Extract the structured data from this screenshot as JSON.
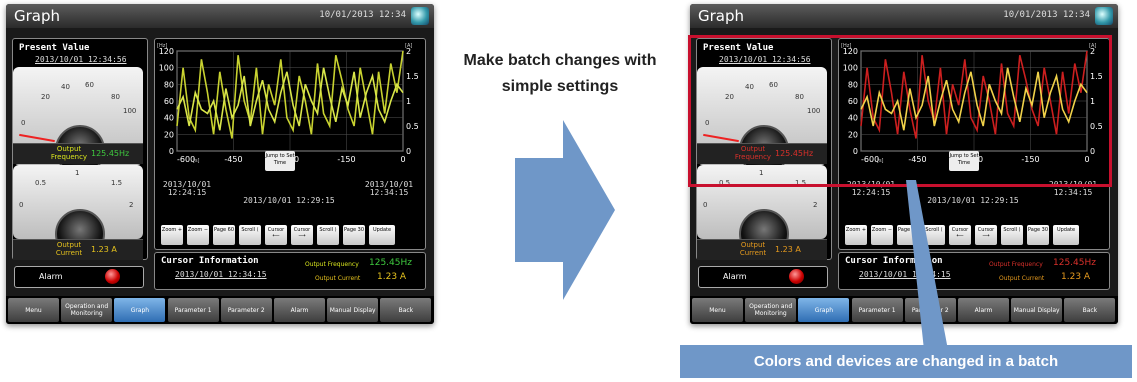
{
  "screens": [
    {
      "title": "Graph",
      "datetime": "10/01/2013 12:34",
      "present_value": {
        "title": "Present Value",
        "datetime": "2013/10/01 12:34:56"
      },
      "meter1": {
        "scale": [
          "20",
          "40",
          "60",
          "80",
          "100",
          "0"
        ],
        "label": "Output Frequency",
        "value": "125.45Hz",
        "label_color": "#d9e51e",
        "value_color": "#3ec93e"
      },
      "meter2": {
        "scale": [
          "0.5",
          "1",
          "1.5",
          "0",
          "2"
        ],
        "label": "Output Current",
        "value": "1.23 A",
        "label_color": "#e5c21e",
        "value_color": "#e5c21e"
      },
      "alarm": {
        "label": "Alarm"
      },
      "graph": {
        "unit_left": "[Hz]",
        "unit_right": "[A]",
        "y_ticks": [
          "120",
          "100",
          "80",
          "60",
          "40",
          "20",
          "0"
        ],
        "y2_ticks": [
          "2",
          "1.5",
          "1",
          "0.5",
          "0"
        ],
        "x_ticks": [
          "-600",
          "-450",
          "-300",
          "-150",
          "0"
        ],
        "x_unit": "[s]",
        "set_time": "Jump to Set Time",
        "date_left": "2013/10/01 12:24:15",
        "date_mid": "2013/10/01 12:29:15",
        "date_right": "2013/10/01 12:34:15"
      },
      "graph_buttons": [
        "Zoom +",
        "Zoom −",
        "Page 60",
        "Scroll ⟨",
        "Cursor ⟵",
        "Cursor ⟶",
        "Scroll ⟩",
        "Page 30",
        "Update"
      ],
      "cursor_info": {
        "title": "Cursor Information",
        "datetime": "2013/10/01 12:34:15",
        "row1_label": "Output Frequency",
        "row1_value": "125.45Hz",
        "row2_label": "Output Current",
        "row2_value": "1.23 A"
      },
      "nav": [
        {
          "label": "Menu",
          "active": false
        },
        {
          "label": "Operation and Monitoring",
          "active": false
        },
        {
          "label": "Graph",
          "active": true
        },
        {
          "label": "Parameter 1",
          "active": false
        },
        {
          "label": "Parameter 2",
          "active": false
        },
        {
          "label": "Alarm",
          "active": false
        },
        {
          "label": "Manual Display",
          "active": false
        },
        {
          "label": "Back",
          "active": false
        }
      ],
      "colors": {
        "series1": "#c8d230",
        "series2": "#d9e64a",
        "grid": "#555555"
      }
    },
    {
      "title": "Graph",
      "datetime": "10/01/2013 12:34",
      "present_value": {
        "title": "Present Value",
        "datetime": "2013/10/01 12:34:56"
      },
      "meter1": {
        "scale": [
          "20",
          "40",
          "60",
          "80",
          "100",
          "0"
        ],
        "label": "Output Frequency",
        "value": "125.45Hz",
        "label_color": "#d8302a",
        "value_color": "#d8302a"
      },
      "meter2": {
        "scale": [
          "0.5",
          "1",
          "1.5",
          "0",
          "2"
        ],
        "label": "Output Current",
        "value": "1.23 A",
        "label_color": "#e59a1e",
        "value_color": "#e59a1e"
      },
      "alarm": {
        "label": "Alarm"
      },
      "graph": {
        "unit_left": "[Hz]",
        "unit_right": "[A]",
        "y_ticks": [
          "120",
          "100",
          "80",
          "60",
          "40",
          "20",
          "0"
        ],
        "y2_ticks": [
          "2",
          "1.5",
          "1",
          "0.5",
          "0"
        ],
        "x_ticks": [
          "-600",
          "-450",
          "-300",
          "-150",
          "0"
        ],
        "x_unit": "[s]",
        "set_time": "Jump to Set Time",
        "date_left": "2013/10/01 12:24:15",
        "date_mid": "2013/10/01 12:29:15",
        "date_right": "2013/10/01 12:34:15"
      },
      "graph_buttons": [
        "Zoom +",
        "Zoom −",
        "Page 60",
        "Scroll ⟨",
        "Cursor ⟵",
        "Cursor ⟶",
        "Scroll ⟩",
        "Page 30",
        "Update"
      ],
      "cursor_info": {
        "title": "Cursor Information",
        "datetime": "2013/10/01 12:34:15",
        "row1_label": "Output Frequency",
        "row1_value": "125.45Hz",
        "row2_label": "Output Current",
        "row2_value": "1.23 A"
      },
      "nav": [
        {
          "label": "Menu",
          "active": false
        },
        {
          "label": "Operation and Monitoring",
          "active": false
        },
        {
          "label": "Graph",
          "active": true
        },
        {
          "label": "Parameter 1",
          "active": false
        },
        {
          "label": "Parameter 2",
          "active": false
        },
        {
          "label": "Alarm",
          "active": false
        },
        {
          "label": "Manual Display",
          "active": false
        },
        {
          "label": "Back",
          "active": false
        }
      ],
      "colors": {
        "series1": "#cc1f1f",
        "series2": "#f0d24a",
        "grid": "#555555"
      }
    }
  ],
  "arrow_text": "Make batch changes with simple settings",
  "callout": "Colors and devices are changed in a batch",
  "annotation_color": "#c8102e",
  "arrow_color": "#6f97c8"
}
